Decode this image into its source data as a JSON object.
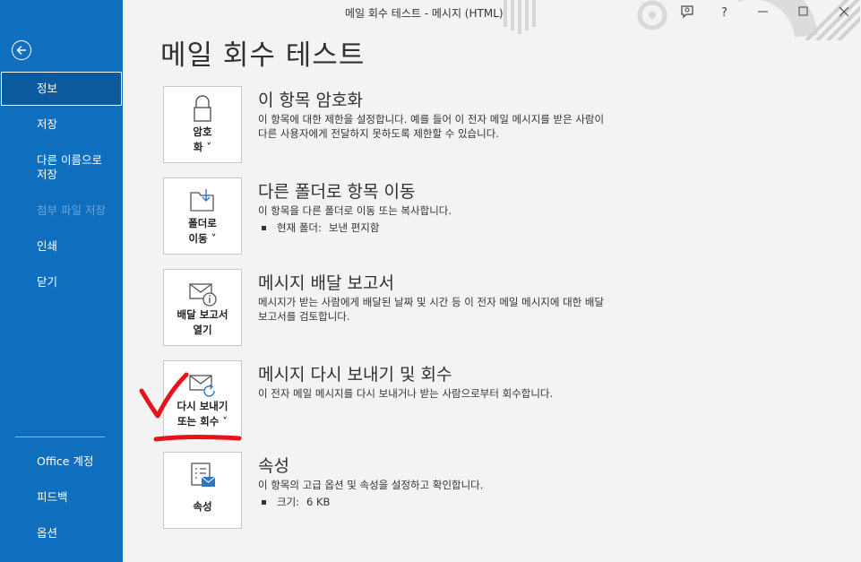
{
  "window": {
    "title": "메일 회수 테스트  -  메시지 (HTML)"
  },
  "sidebar": {
    "items": [
      {
        "label": "정보"
      },
      {
        "label": "저장"
      },
      {
        "label": "다른 이름으로 저장"
      },
      {
        "label": "첨부 파일 저장"
      },
      {
        "label": "인쇄"
      },
      {
        "label": "닫기"
      },
      {
        "label": "Office 계정"
      },
      {
        "label": "피드백"
      },
      {
        "label": "옵션"
      }
    ]
  },
  "main": {
    "title": "메일 회수 테스트",
    "sections": [
      {
        "button_line1": "암호",
        "button_line2": "화 ˅",
        "title": "이 항목 암호화",
        "desc_line1": "이 항목에 대한 제한을 설정합니다. 예를 들어 이 전자 메일 메시지를 받은 사람이",
        "desc_line2": "다른 사용자에게 전달하지 못하도록 제한할 수 있습니다."
      },
      {
        "button_line1": "폴더로",
        "button_line2": "이동 ˅",
        "title": "다른 폴더로 항목 이동",
        "desc_line1": "이 항목을 다른 폴더로 이동 또는 복사합니다.",
        "bullet_label": "현재 폴더:",
        "bullet_value": "보낸 편지함"
      },
      {
        "button_line1": "배달 보고서",
        "button_line2": "열기",
        "title": "메시지 배달 보고서",
        "desc_line1": "메시지가 받는 사람에게 배달된 날짜 및 시간 등 이 전자 메일 메시지에 대한 배달",
        "desc_line2": "보고서를 검토합니다."
      },
      {
        "button_line1": "다시 보내기",
        "button_line2": "또는 회수 ˅",
        "title": "메시지 다시 보내기 및 회수",
        "desc_line1": "이 전자 메일 메시지를 다시 보내거나 받는 사람으로부터 회수합니다."
      },
      {
        "button_line1": "속성",
        "title": "속성",
        "desc_line1": "이 항목의 고급 옵션 및 속성을 설정하고 확인합니다.",
        "bullet_label": "크기:",
        "bullet_value": "6 KB"
      }
    ]
  },
  "icons": [
    "back-arrow-icon",
    "coauthor-icon",
    "help-icon",
    "minimize-icon",
    "maximize-icon",
    "close-icon",
    "lock-icon",
    "folder-move-icon",
    "envelope-info-icon",
    "envelope-resend-icon",
    "properties-icon",
    "red-checkmark-annotation"
  ],
  "colors": {
    "sidebar": "#106ebe",
    "sidebar_active": "#0c5a9e",
    "annotation": "#e8131a",
    "accent_icon": "#2b79c2"
  }
}
